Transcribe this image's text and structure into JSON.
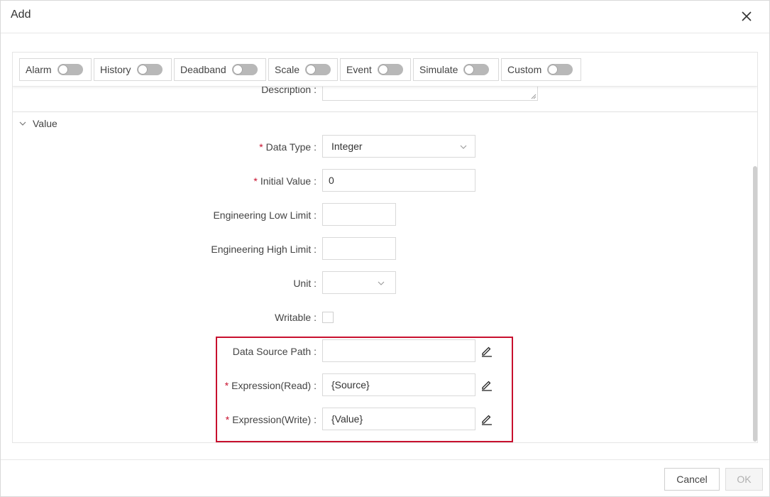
{
  "dialog": {
    "title": "Add"
  },
  "toolbar": {
    "toggles": [
      {
        "label": "Alarm",
        "on": false
      },
      {
        "label": "History",
        "on": false
      },
      {
        "label": "Deadband",
        "on": false
      },
      {
        "label": "Scale",
        "on": false
      },
      {
        "label": "Event",
        "on": false
      },
      {
        "label": "Simulate",
        "on": false
      },
      {
        "label": "Custom",
        "on": false
      }
    ]
  },
  "form": {
    "description_label": "Description :",
    "section_title": "Value",
    "required_mark": "*",
    "data_type": {
      "label": "Data Type :",
      "value": "Integer"
    },
    "initial_value": {
      "label": "Initial Value :",
      "value": "0"
    },
    "eng_low": {
      "label": "Engineering Low Limit :",
      "value": ""
    },
    "eng_high": {
      "label": "Engineering High Limit :",
      "value": ""
    },
    "unit": {
      "label": "Unit :",
      "value": ""
    },
    "writable": {
      "label": "Writable :",
      "checked": false
    },
    "data_source_path": {
      "label": "Data Source Path :",
      "value": ""
    },
    "expr_read": {
      "label": "Expression(Read) :",
      "value": "{Source}"
    },
    "expr_write": {
      "label": "Expression(Write) :",
      "value": "{Value}"
    }
  },
  "footer": {
    "cancel_label": "Cancel",
    "ok_label": "OK",
    "ok_disabled": true
  },
  "colors": {
    "required": "#c8102e",
    "highlight_border": "#c8102e",
    "toggle_off": "#b8b8b8"
  }
}
